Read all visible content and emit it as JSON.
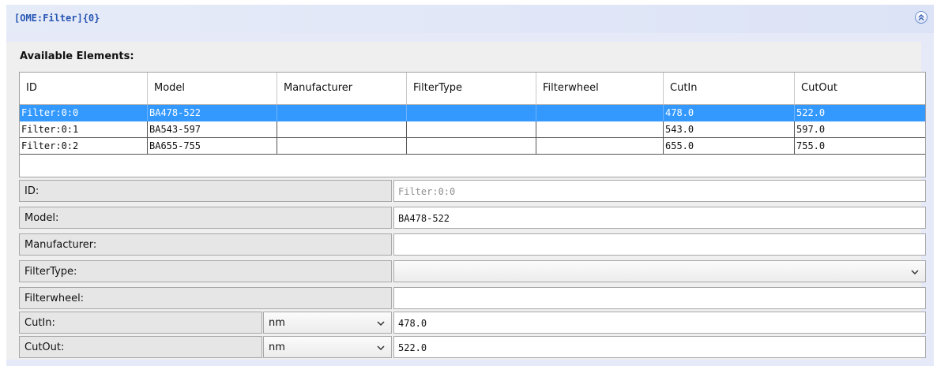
{
  "panel": {
    "title": "[OME:Filter]{0}",
    "collapse_icon": "double-chevron-up-icon"
  },
  "group": {
    "label": "Available Elements:"
  },
  "table": {
    "columns": [
      "ID",
      "Model",
      "Manufacturer",
      "FilterType",
      "Filterwheel",
      "CutIn",
      "CutOut"
    ],
    "rows": [
      [
        "Filter:0:0",
        "BA478-522",
        "",
        "",
        "",
        "478.0",
        "522.0"
      ],
      [
        "Filter:0:1",
        "BA543-597",
        "",
        "",
        "",
        "543.0",
        "597.0"
      ],
      [
        "Filter:0:2",
        "BA655-755",
        "",
        "",
        "",
        "655.0",
        "755.0"
      ]
    ],
    "selected_row": 0,
    "selection_color": "#3399ff"
  },
  "form": {
    "id_label": "ID:",
    "id_value": "Filter:0:0",
    "model_label": "Model:",
    "model_value": "BA478-522",
    "manufacturer_label": "Manufacturer:",
    "manufacturer_value": "",
    "filtertype_label": "FilterType:",
    "filtertype_value": "",
    "filterwheel_label": "Filterwheel:",
    "filterwheel_value": "",
    "cutin_label": "CutIn:",
    "cutin_unit": "nm",
    "cutin_value": "478.0",
    "cutout_label": "CutOut:",
    "cutout_unit": "nm",
    "cutout_value": "522.0"
  },
  "colors": {
    "title_text": "#2756b3",
    "panel_bg": "#e6e9f7"
  }
}
